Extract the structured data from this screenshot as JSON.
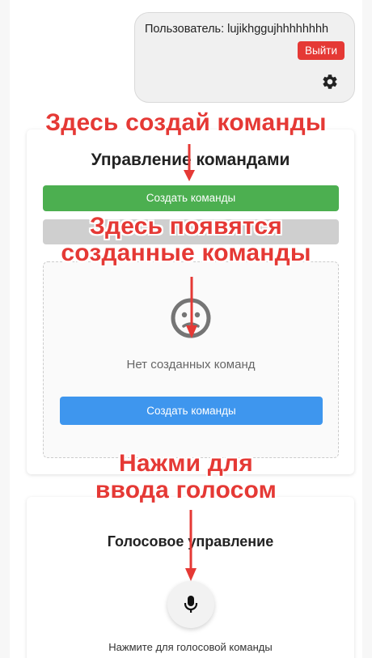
{
  "user_panel": {
    "user_label": "Пользователь: lujikhggujhhhhhhhh",
    "logout_label": "Выйти",
    "gear_icon": "gear-icon"
  },
  "commands_card": {
    "title": "Управление командами",
    "create_button_label": "Создать команды",
    "secondary_button_label": "",
    "empty_state": {
      "icon": "sad-face-icon",
      "text": "Нет созданных команд",
      "create_button_label": "Создать команды"
    }
  },
  "voice_card": {
    "title": "Голосовое управление",
    "mic_icon": "microphone-icon",
    "hint": "Нажмите для голосовой команды"
  },
  "annotations": {
    "create_here": "Здесь создай команды",
    "appear_here": "Здесь появятся\nсозданные команды",
    "press_voice": "Нажми для\nввода голосом"
  },
  "colors": {
    "accent_green": "#4caf50",
    "accent_blue": "#3e96ee",
    "logout_red": "#e53935",
    "annotation_red": "#e53935"
  }
}
